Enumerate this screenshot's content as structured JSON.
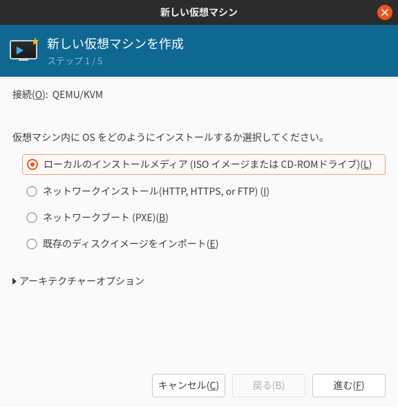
{
  "window": {
    "title": "新しい仮想マシン"
  },
  "header": {
    "title": "新しい仮想マシンを作成",
    "step": "ステップ 1 / 5"
  },
  "connection": {
    "label_prefix": "接続(",
    "label_hotkey": "O",
    "label_suffix": "):",
    "value": "QEMU/KVM"
  },
  "prompt": "仮想マシン内に OS をどのようにインストールするか選択してください。",
  "options": [
    {
      "text": "ローカルのインストールメディア (ISO イメージまたは CD-ROMドライブ)(",
      "hotkey": "L",
      "suffix": ")",
      "selected": true
    },
    {
      "text": "ネットワークインストール(HTTP, HTTPS, or FTP) (",
      "hotkey": "I",
      "suffix": ")",
      "selected": false
    },
    {
      "text": "ネットワークブート (PXE)(",
      "hotkey": "B",
      "suffix": ")",
      "selected": false
    },
    {
      "text": "既存のディスクイメージをインポート(",
      "hotkey": "E",
      "suffix": ")",
      "selected": false
    }
  ],
  "arch": {
    "label": "アーキテクチャーオプション"
  },
  "buttons": {
    "cancel_prefix": "キャンセル(",
    "cancel_hotkey": "C",
    "cancel_suffix": ")",
    "back": "戻る(B)",
    "forward_prefix": "進む(",
    "forward_hotkey": "F",
    "forward_suffix": ")"
  }
}
